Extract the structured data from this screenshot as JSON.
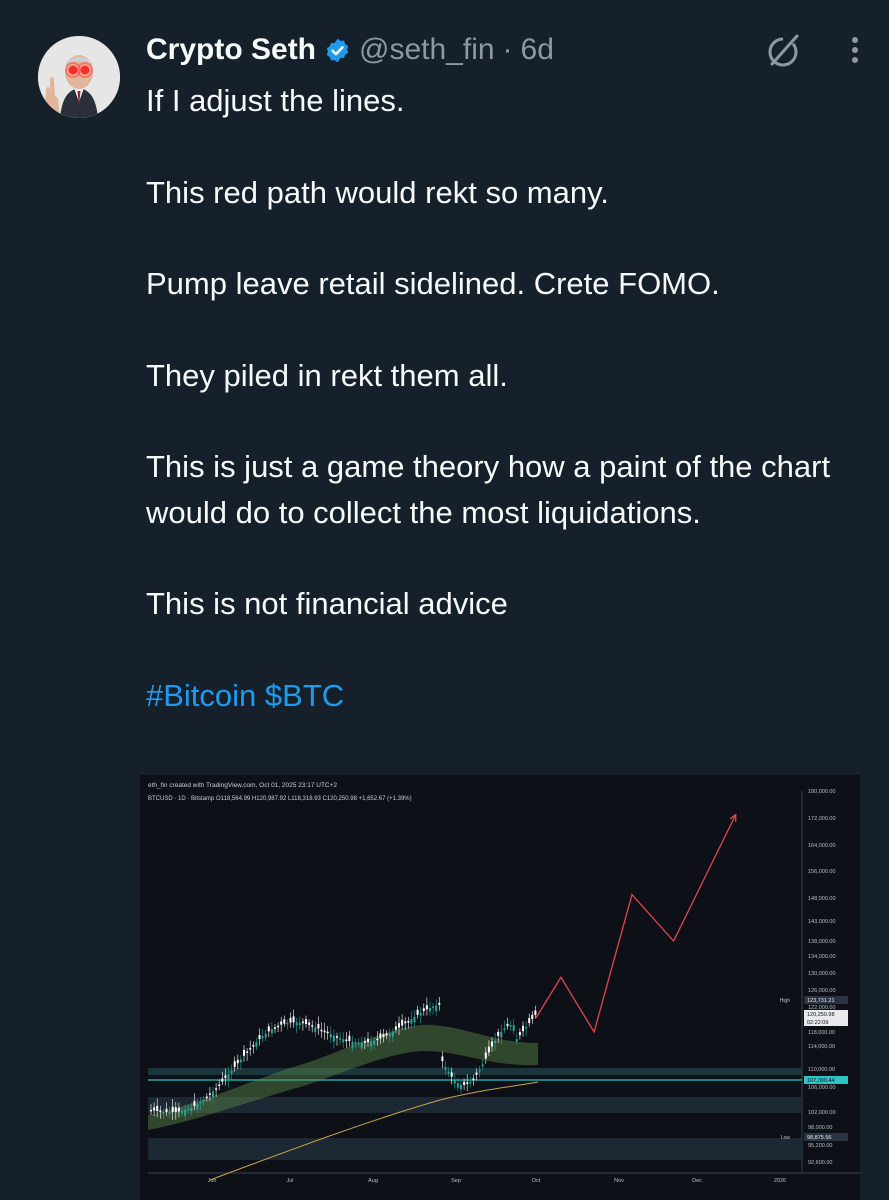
{
  "tweet": {
    "author_name": "Crypto Seth",
    "handle": "@seth_fin",
    "separator": "·",
    "time": "6d",
    "paragraphs": [
      "If I adjust the lines.",
      "This red path would rekt so many.",
      "Pump leave retail sidelined. Crete FOMO.",
      "They piled in rekt them all.",
      "This is just a game theory how a paint of the chart would do to collect the most liquidations.",
      "This is not financial advice"
    ],
    "hashtags": "#Bitcoin $BTC"
  },
  "icons": {
    "verified": "verified-badge-icon",
    "grok": "grok-icon",
    "more": "more-vertical-icon"
  },
  "colors": {
    "background": "#15202b",
    "text": "#f7f9f9",
    "muted": "#8b98a5",
    "accent": "#1d9bf0",
    "chart_bg": "#0d1117",
    "red_path": "#e0454a",
    "bull_candle": "#26a69a",
    "bear_candle": "#ffffff",
    "support_line": "#2ec4c4",
    "moving_average": "#c8a24a",
    "ribbon": "#5a8a4a"
  },
  "chart_data": {
    "type": "line",
    "header_line": "eth_fin created with TradingView.com, Oct 01, 2025 23:17 UTC+2",
    "legend_line": "BTCUSD · 1D · Bitstamp  O118,564.99  H120,987.92  L118,318.93  C120,250.98  +1,652.67 (+1.39%)",
    "x_ticks": [
      "Jun",
      "Jul",
      "Aug",
      "Sep",
      "Oct",
      "Nov",
      "Dec",
      "2026"
    ],
    "y_ticks": [
      "180,000.00",
      "172,000.00",
      "164,000.00",
      "156,000.00",
      "148,000.00",
      "143,000.00",
      "138,000.00",
      "134,000.00",
      "130,000.00",
      "126,000.00",
      "122,000.00",
      "118,000.00",
      "114,000.00",
      "110,000.00",
      "106,000.00",
      "102,000.00",
      "98,000.00",
      "95,200.00",
      "92,600.00"
    ],
    "markers": {
      "high_label": "High",
      "high_value": "123,731.21",
      "current_price": "120,250.98",
      "countdown": "02:22:09",
      "line_price": "107,390.44",
      "low_label": "Low",
      "low_value": "98,875.56"
    },
    "series": [
      {
        "name": "",
        "color": "red",
        "values_note": "",
        "x": [
          "Oct 01",
          "Oct 10",
          "Oct 22",
          "Nov 06",
          "Nov 22",
          "Dec 15"
        ],
        "y": [
          120250,
          129000,
          118000,
          149000,
          138000,
          173000
        ]
      }
    ]
  }
}
